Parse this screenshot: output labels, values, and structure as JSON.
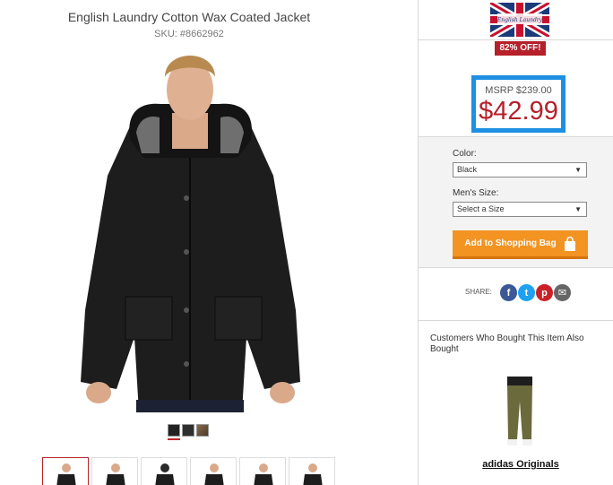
{
  "product": {
    "title": "English Laundry Cotton Wax Coated Jacket",
    "sku_label": "SKU:",
    "sku": "#8662962"
  },
  "swatches": [
    {
      "name": "black",
      "color": "#222222"
    },
    {
      "name": "charcoal",
      "color": "#2f2f2f"
    },
    {
      "name": "tan",
      "color": "#8a6a4a"
    }
  ],
  "thumbnails_count": 6,
  "brand": {
    "logo_text": "English Laundry",
    "discount_badge": "82% OFF!"
  },
  "pricing": {
    "msrp": "MSRP $239.00",
    "price": "$42.99"
  },
  "options": {
    "color_label": "Color:",
    "color_value": "Black",
    "size_label": "Men's Size:",
    "size_value": "Select a Size",
    "add_button": "Add to Shopping Bag"
  },
  "share": {
    "label": "SHARE:",
    "icons": [
      "facebook-icon",
      "twitter-icon",
      "pinterest-icon",
      "email-icon"
    ]
  },
  "recommendations": {
    "heading": "Customers Who Bought This Item Also Bought",
    "items": [
      {
        "brand": "adidas Originals"
      }
    ]
  },
  "colors": {
    "accent_red": "#b5202a",
    "price_frame_blue": "#1e8fe1",
    "button_orange": "#f29322"
  }
}
